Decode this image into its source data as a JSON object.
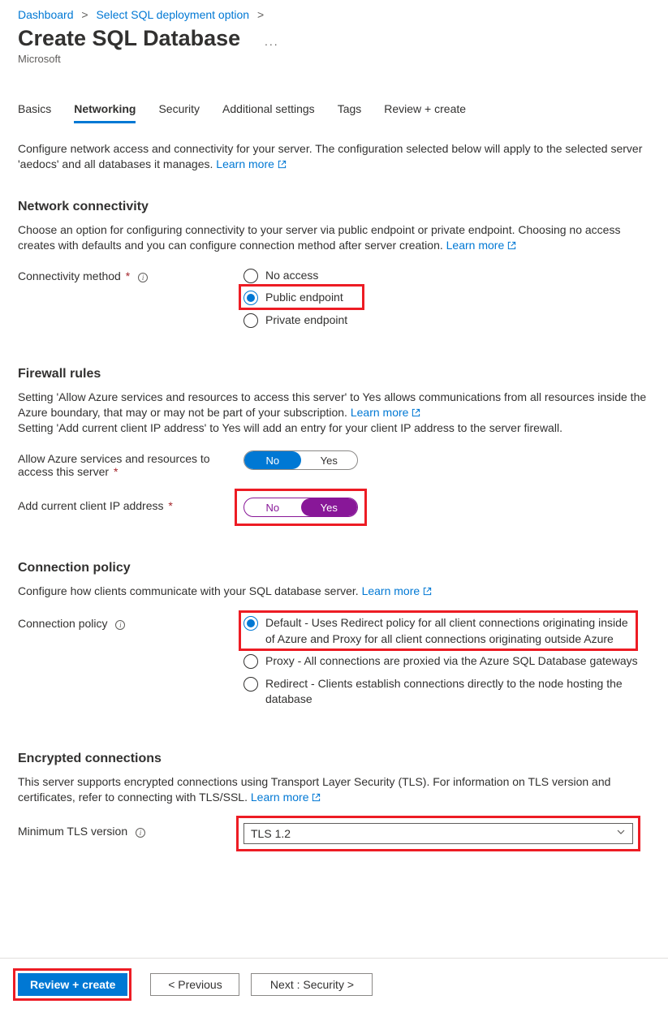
{
  "breadcrumb": {
    "items": [
      "Dashboard",
      "Select SQL deployment option"
    ]
  },
  "header": {
    "title": "Create SQL Database",
    "dots": "...",
    "subtitle": "Microsoft"
  },
  "tabs": {
    "items": [
      "Basics",
      "Networking",
      "Security",
      "Additional settings",
      "Tags",
      "Review + create"
    ],
    "active_index": 1
  },
  "networking": {
    "intro_a": "Configure network access and connectivity for your server. The configuration selected below will apply to the selected server 'aedocs' and all databases it manages. ",
    "intro_learn": "Learn more",
    "network_connectivity": {
      "heading": "Network connectivity",
      "desc_a": "Choose an option for configuring connectivity to your server via public endpoint or private endpoint. Choosing no access creates with defaults and you can configure connection method after server creation. ",
      "desc_learn": "Learn more",
      "field_label": "Connectivity method",
      "options": [
        "No access",
        "Public endpoint",
        "Private endpoint"
      ],
      "selected_index": 1
    },
    "firewall": {
      "heading": "Firewall rules",
      "desc_a": "Setting 'Allow Azure services and resources to access this server' to Yes allows communications from all resources inside the Azure boundary, that may or may not be part of your subscription. ",
      "desc_learn": "Learn more",
      "desc_b": "Setting 'Add current client IP address' to Yes will add an entry for your client IP address to the server firewall.",
      "allow_azure": {
        "label": "Allow Azure services and resources to access this server",
        "no": "No",
        "yes": "Yes",
        "value": "No"
      },
      "add_ip": {
        "label": "Add current client IP address",
        "no": "No",
        "yes": "Yes",
        "value": "Yes"
      }
    },
    "connection_policy": {
      "heading": "Connection policy",
      "desc_a": "Configure how clients communicate with your SQL database server. ",
      "desc_learn": "Learn more",
      "field_label": "Connection policy",
      "options": [
        "Default - Uses Redirect policy for all client connections originating inside of Azure and Proxy for all client connections originating outside Azure",
        "Proxy - All connections are proxied via the Azure SQL Database gateways",
        "Redirect - Clients establish connections directly to the node hosting the database"
      ],
      "selected_index": 0
    },
    "encrypted": {
      "heading": "Encrypted connections",
      "desc_a": "This server supports encrypted connections using Transport Layer Security (TLS). For information on TLS version and certificates, refer to connecting with TLS/SSL. ",
      "desc_learn": "Learn more",
      "field_label": "Minimum TLS version",
      "value": "TLS 1.2"
    }
  },
  "footer": {
    "review": "Review + create",
    "previous": "< Previous",
    "next": "Next : Security >"
  }
}
